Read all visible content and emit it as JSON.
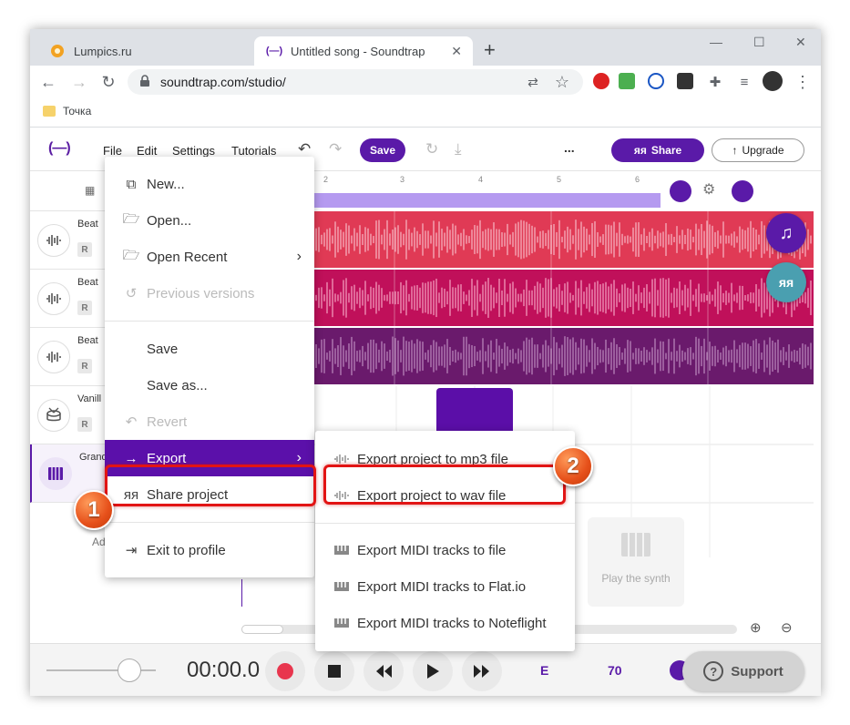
{
  "browser": {
    "tabs": [
      {
        "title": "Lumpics.ru",
        "active": false
      },
      {
        "title": "Untitled song - Soundtrap",
        "active": true
      }
    ],
    "url": "soundtrap.com/studio/",
    "bookmark": "Точка"
  },
  "app": {
    "logo": "(—)",
    "menu": [
      "File",
      "Edit",
      "Settings",
      "Tutorials"
    ],
    "save_label": "Save",
    "more_label": "...",
    "share_label": "Share",
    "upgrade_label": "Upgrade",
    "ruler_numbers": [
      "2",
      "3",
      "4",
      "5",
      "6"
    ],
    "tracks": [
      {
        "name": "Beat",
        "badge": "R"
      },
      {
        "name": "Beat",
        "badge": "R"
      },
      {
        "name": "Beat",
        "badge": "R"
      },
      {
        "name": "Vanill",
        "badge": "R"
      },
      {
        "name": "Grand",
        "badge": ""
      }
    ],
    "add_track_label": "Ad",
    "synth_card_label": "Play the synth",
    "time": "00:00.0",
    "key": "E",
    "bpm": "70",
    "support_label": "Support"
  },
  "file_menu": {
    "items": [
      {
        "label": "New...",
        "icon": "copy-icon",
        "disabled": false
      },
      {
        "label": "Open...",
        "icon": "folder-open-icon",
        "disabled": false
      },
      {
        "label": "Open Recent",
        "icon": "folder-open-icon",
        "disabled": false,
        "submenu": true
      },
      {
        "label": "Previous versions",
        "icon": "history-icon",
        "disabled": true
      },
      {
        "label": "Save",
        "icon": "",
        "disabled": false
      },
      {
        "label": "Save as...",
        "icon": "",
        "disabled": false
      },
      {
        "label": "Revert",
        "icon": "undo-icon",
        "disabled": true
      },
      {
        "label": "Export",
        "icon": "arrow-right-icon",
        "disabled": false,
        "submenu": true,
        "highlighted": true
      },
      {
        "label": "Share project",
        "icon": "people-icon",
        "disabled": false
      },
      {
        "label": "Exit to profile",
        "icon": "exit-icon",
        "disabled": false
      }
    ]
  },
  "export_menu": {
    "items": [
      {
        "label": "Export project to mp3 file",
        "icon": "waveform-icon"
      },
      {
        "label": "Export project to wav file",
        "icon": "waveform-icon"
      },
      {
        "label": "Export MIDI tracks to file",
        "icon": "midi-icon"
      },
      {
        "label": "Export MIDI tracks to Flat.io",
        "icon": "midi-icon"
      },
      {
        "label": "Export MIDI tracks to Noteflight",
        "icon": "midi-icon"
      }
    ]
  },
  "annotations": {
    "step1": "1",
    "step2": "2"
  },
  "colors": {
    "accent": "#5a1aa8",
    "lane1": "#e03a55",
    "lane2": "#c0105a",
    "lane3": "#6a1a6c",
    "highlight_red": "#e21414",
    "step_badge": "#e6501a"
  }
}
